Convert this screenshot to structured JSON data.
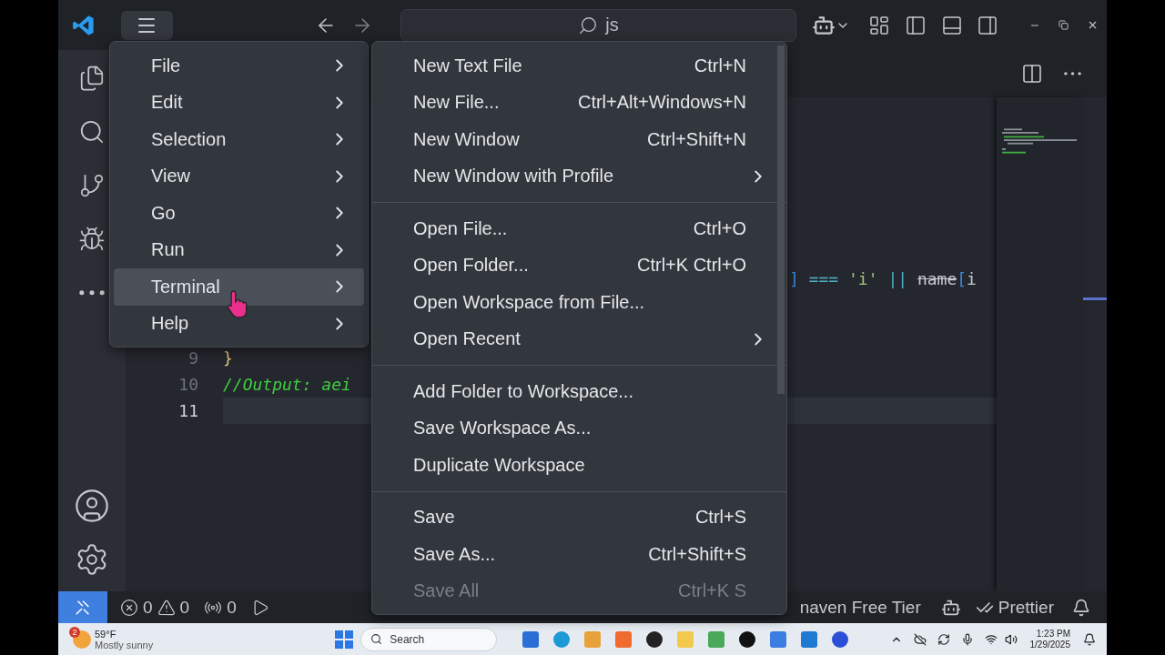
{
  "title_bar": {
    "search": "js"
  },
  "main_menu": [
    {
      "label": "File",
      "highlighted": false
    },
    {
      "label": "Edit",
      "highlighted": false
    },
    {
      "label": "Selection",
      "highlighted": false
    },
    {
      "label": "View",
      "highlighted": false
    },
    {
      "label": "Go",
      "highlighted": false
    },
    {
      "label": "Run",
      "highlighted": false
    },
    {
      "label": "Terminal",
      "highlighted": true
    },
    {
      "label": "Help",
      "highlighted": false
    }
  ],
  "submenu": {
    "groups": [
      {
        "items": [
          {
            "label": "New Text File",
            "shortcut": "Ctrl+N",
            "has_submenu": false,
            "disabled": false
          },
          {
            "label": "New File...",
            "shortcut": "Ctrl+Alt+Windows+N",
            "has_submenu": false,
            "disabled": false
          },
          {
            "label": "New Window",
            "shortcut": "Ctrl+Shift+N",
            "has_submenu": false,
            "disabled": false
          },
          {
            "label": "New Window with Profile",
            "has_submenu": true,
            "disabled": false
          }
        ]
      },
      {
        "items": [
          {
            "label": "Open File...",
            "shortcut": "Ctrl+O",
            "has_submenu": false,
            "disabled": false
          },
          {
            "label": "Open Folder...",
            "shortcut": "Ctrl+K Ctrl+O",
            "has_submenu": false,
            "disabled": false
          },
          {
            "label": "Open Workspace from File...",
            "has_submenu": false,
            "disabled": false
          },
          {
            "label": "Open Recent",
            "has_submenu": true,
            "disabled": false
          }
        ]
      },
      {
        "items": [
          {
            "label": "Add Folder to Workspace...",
            "has_submenu": false,
            "disabled": false
          },
          {
            "label": "Save Workspace As...",
            "has_submenu": false,
            "disabled": false
          },
          {
            "label": "Duplicate Workspace",
            "has_submenu": false,
            "disabled": false
          }
        ]
      },
      {
        "items": [
          {
            "label": "Save",
            "shortcut": "Ctrl+S",
            "has_submenu": false,
            "disabled": false
          },
          {
            "label": "Save As...",
            "shortcut": "Ctrl+Shift+S",
            "has_submenu": false,
            "disabled": false
          },
          {
            "label": "Save All",
            "shortcut": "Ctrl+K S",
            "has_submenu": false,
            "disabled": true
          }
        ]
      }
    ]
  },
  "editor": {
    "lines": [
      {
        "current": false,
        "tokens": [
          {
            "text": "]",
            "kind": "bracket"
          },
          {
            "text": " === ",
            "kind": "operator"
          },
          {
            "text": "'i'",
            "kind": "string"
          },
          {
            "text": " || ",
            "kind": "operator"
          },
          {
            "text": "name",
            "kind": "deprecated"
          },
          {
            "text": "[",
            "kind": "bracket"
          },
          {
            "text": "i",
            "kind": "plain"
          }
        ]
      },
      {
        "number": "9",
        "current": false,
        "tokens": [
          {
            "text": "}",
            "kind": "brace"
          }
        ]
      },
      {
        "number": "10",
        "current": false,
        "tokens": [
          {
            "text": "//Output: aei",
            "kind": "comment"
          }
        ]
      },
      {
        "number": "11",
        "current": true
      }
    ]
  },
  "status_bar": {
    "errors": "0",
    "warnings": "0",
    "ports": "0",
    "extension": "naven Free Tier",
    "formatter": "Prettier"
  },
  "taskbar": {
    "weather_badge": "2",
    "temperature": "59°F",
    "condition": "Mostly sunny",
    "search": "Search",
    "time": "1:23 PM",
    "date": "1/29/2025"
  }
}
